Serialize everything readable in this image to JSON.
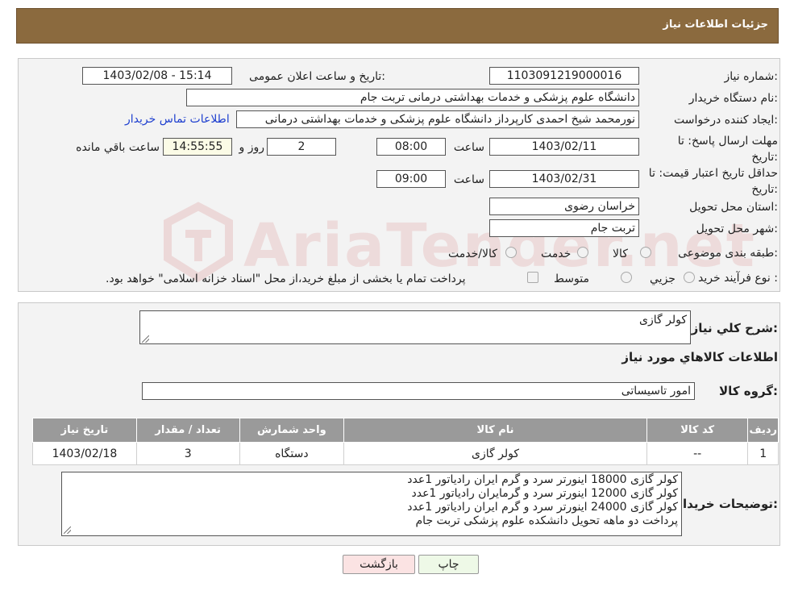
{
  "header": {
    "title": "جزئیات اطلاعات نیاز"
  },
  "form": {
    "need_number_label": "شماره نیاز:",
    "need_number": "1103091219000016",
    "announce_label": "تاریخ و ساعت اعلان عمومی:",
    "announce_value": "1403/02/08 - 15:14",
    "buyer_org_label": "نام دستگاه خریدار:",
    "buyer_org": "دانشگاه علوم پزشکی و خدمات بهداشتی  درمانی تربت جام",
    "creator_label": "ایجاد کننده درخواست:",
    "creator": "نورمحمد شیخ احمدی کارپرداز دانشگاه علوم پزشکی و خدمات بهداشتی  درمانی",
    "contact_link": "اطلاعات تماس خریدار",
    "deadline_label": "مهلت ارسال پاسخ: تا تاریخ:",
    "deadline_date": "1403/02/11",
    "time_label": "ساعت",
    "deadline_time": "08:00",
    "days_value": "2",
    "days_label": "روز و",
    "remaining_time": "14:55:55",
    "remaining_label": "ساعت باقي مانده",
    "price_validity_label": "حداقل تاریخ اعتبار قیمت: تا تاریخ:",
    "price_validity_date": "1403/02/31",
    "price_validity_time": "09:00",
    "province_label": "استان محل تحویل:",
    "province": "خراسان رضوی",
    "city_label": "شهر محل تحویل:",
    "city": "تربت جام",
    "category_label": "طبقه بندی موضوعی:",
    "category_options": [
      "کالا",
      "خدمت",
      "کالا/خدمت"
    ],
    "process_label": "نوع فرآیند خرید :",
    "process_options": [
      "جزیي",
      "متوسط"
    ],
    "payment_note": "پرداخت تمام یا بخشی از مبلغ خرید،از محل \"اسناد خزانه اسلامی\" خواهد بود."
  },
  "details": {
    "general_desc_label": "شرح کلي نياز:",
    "general_desc": "کولر گازی",
    "goods_info_title": "اطلاعات کالاهاي مورد نياز",
    "goods_group_label": "گروه کالا:",
    "goods_group": "امور تاسیساتی",
    "table_headers": [
      "ردیف",
      "کد کالا",
      "نام کالا",
      "واحد شمارش",
      "تعداد / مقدار",
      "تاریخ نیاز"
    ],
    "rows": [
      [
        "1",
        "--",
        "کولر گازی",
        "دستگاه",
        "3",
        "1403/02/18"
      ]
    ],
    "buyer_notes_label": "توضیحات خریدار:",
    "buyer_notes": [
      "کولر گازی 18000 اینورتر سرد و گرم ایران رادیاتور 1عدد",
      "کولر گازی 12000 اینورتر سرد و گرمایران رادیاتور 1عدد",
      "کولر گازی 24000 اینورتر سرد و گرم ایران رادیاتور 1عدد",
      "پرداخت دو ماهه تحویل دانشکده علوم پزشکی تربت جام"
    ]
  },
  "buttons": {
    "print": "چاپ",
    "back": "بازگشت"
  },
  "watermark": "AriaTender.net"
}
